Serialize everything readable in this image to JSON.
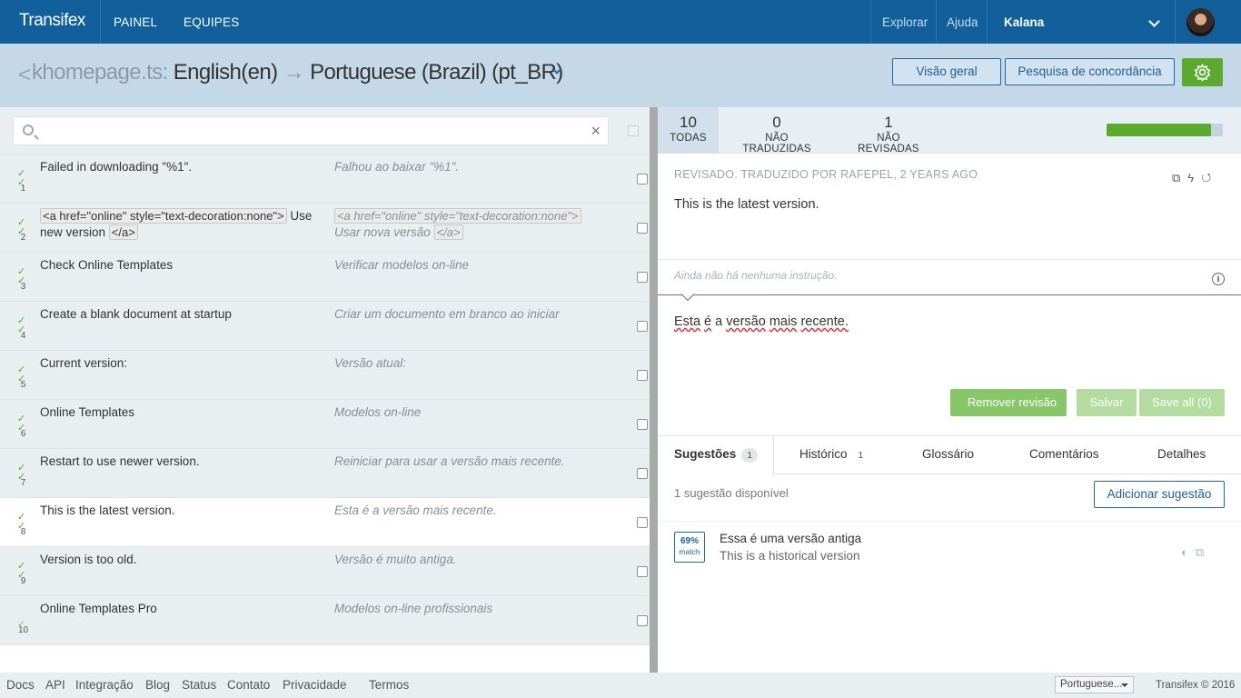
{
  "topbar": {
    "brand": "Transifex",
    "nav": [
      "PAINEL",
      "EQUIPES"
    ],
    "explore": "Explorar",
    "help": "Ajuda",
    "user": "Kalana"
  },
  "header": {
    "back": "<",
    "file": "khomepage.ts:",
    "source_lang": "English(en)",
    "arrow": "→",
    "target_lang": "Portuguese (Brazil) (pt_BR)",
    "overview_label": "Visão geral",
    "concordance_label": "Pesquisa de concordância"
  },
  "search": {
    "placeholder": "",
    "clear": "×"
  },
  "strings": [
    {
      "num": "1",
      "source": "Failed in downloading \"%1\".",
      "translation": "Falhou ao baixar \"%1\".",
      "status": "reviewed"
    },
    {
      "num": "2",
      "source_parts": [
        "<a href=\"online\" style=\"text-decoration:none\">",
        " Use new version ",
        "</a>"
      ],
      "translation_parts": [
        "<a href=\"online\" style=\"text-decoration:none\">",
        " Usar nova versão ",
        "</a>"
      ],
      "status": "reviewed"
    },
    {
      "num": "3",
      "source": "Check Online Templates",
      "translation": "Verificar modelos on-line",
      "status": "reviewed"
    },
    {
      "num": "4",
      "source": "Create a blank document at startup",
      "translation": "Criar um documento em branco ao iniciar",
      "status": "reviewed"
    },
    {
      "num": "5",
      "source": "Current version:",
      "translation": "Versão atual:",
      "status": "reviewed"
    },
    {
      "num": "6",
      "source": "Online Templates",
      "translation": "Modelos on-line",
      "status": "reviewed"
    },
    {
      "num": "7",
      "source": "Restart to use newer version.",
      "translation": "Reiniciar para usar a versão mais recente.",
      "status": "reviewed"
    },
    {
      "num": "8",
      "source": "This is the latest version.",
      "translation": "Esta é a versão mais recente.",
      "status": "reviewed",
      "selected": true
    },
    {
      "num": "9",
      "source": "Version is too old.",
      "translation": "Versão é muito antiga.",
      "status": "reviewed"
    },
    {
      "num": "10",
      "source": "Online Templates Pro",
      "translation": "Modelos on-line profissionais",
      "status": "translated"
    }
  ],
  "stats": {
    "all": {
      "count": "10",
      "label": "TODAS"
    },
    "untranslated": {
      "count": "0",
      "label": "NÃO TRADUZIDAS"
    },
    "unreviewed": {
      "count": "1",
      "label": "NÃO REVISADAS"
    },
    "progress_fraction": 0.9
  },
  "editor": {
    "meta": "REVISADO. TRADUZIDO POR RAFEPEL, 2 YEARS AGO",
    "source": "This is the latest version.",
    "instruction_placeholder": "Ainda não há nenhuma instrução.",
    "info": "i",
    "translation_words": [
      "Esta",
      " ",
      "é",
      " a ",
      "versão",
      " ",
      "mais",
      " ",
      "recente."
    ],
    "remove_review": "Remover revisão",
    "save": "Salvar",
    "save_all": "Save all (0)"
  },
  "tabs": {
    "suggestions": {
      "label": "Sugestões",
      "count": "1"
    },
    "history": {
      "label": "Histórico",
      "count": "1"
    },
    "glossary": {
      "label": "Glossário"
    },
    "comments": {
      "label": "Comentários"
    },
    "details": {
      "label": "Detalhes"
    }
  },
  "suggestions": {
    "available": "1 sugestão disponível",
    "add_label": "Adicionar sugestão",
    "items": [
      {
        "match": "69%",
        "match_label": "match",
        "translation": "Essa é uma versão antiga",
        "source": "This is a historical version"
      }
    ]
  },
  "footer": {
    "links": [
      "Docs",
      "API",
      "Integração",
      "Blog",
      "Status",
      "Contato",
      "Privacidade",
      "Termos"
    ],
    "language": "Portuguese...",
    "copyright": "Transifex © 2016"
  },
  "colors": {
    "topbar": "#11609b",
    "header": "#c4d8e8",
    "accent_green": "#5aab2d",
    "link_blue": "#1f6aa5"
  }
}
